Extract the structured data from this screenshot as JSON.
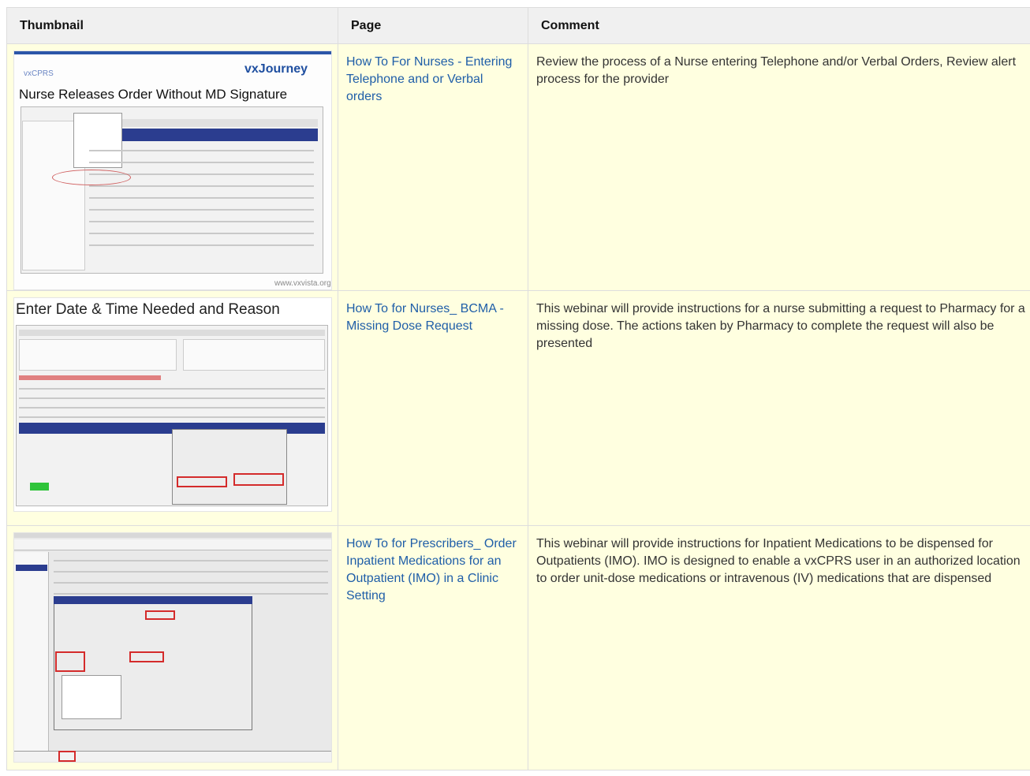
{
  "table": {
    "headers": [
      "Thumbnail",
      "Page",
      "Comment"
    ],
    "rows": [
      {
        "page": "How To For Nurses - Entering Telephone and or Verbal orders",
        "comment": "Review the process of a Nurse entering Telephone and/or Verbal Orders, Review alert process for the provider",
        "thumb": {
          "corner": "vxCPRS",
          "logo": "vxJourney",
          "heading": "Nurse Releases Order Without MD Signature",
          "footer": "www.vxvista.org"
        }
      },
      {
        "page": "How To for Nurses_ BCMA - Missing Dose Request",
        "comment": "This webinar will provide instructions for a nurse submitting a request to Pharmacy for a missing dose. The actions taken by Pharmacy to complete the request will also be presented",
        "thumb": {
          "heading": "Enter Date & Time Needed and Reason"
        }
      },
      {
        "page": "How To for Prescribers_ Order Inpatient Medications for an Outpatient (IMO) in a Clinic Setting",
        "comment": "This webinar will provide instructions for Inpatient Medications to be dispensed for Outpatients (IMO). IMO is designed to enable a vxCPRS user in an authorized location to order unit-dose medications or intravenous (IV) medications that are dispensed",
        "thumb": {}
      }
    ]
  },
  "colors": {
    "link": "#1f5ea8",
    "row_bg": "#ffffe0",
    "header_bg": "#f0f0f0",
    "border": "#dddddd"
  }
}
